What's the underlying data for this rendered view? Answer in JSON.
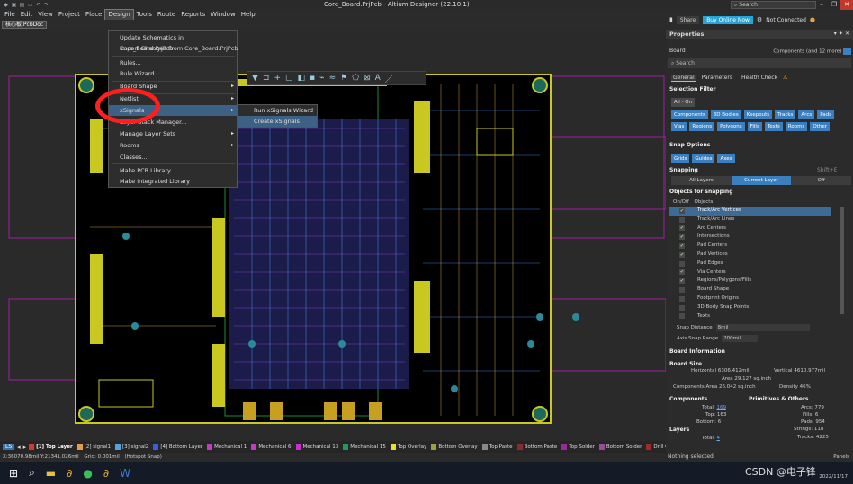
{
  "window": {
    "title": "Core_Board.PrjPcb - Altium Designer (22.10.1)",
    "search": "Search"
  },
  "menubar": {
    "items": [
      "File",
      "Edit",
      "View",
      "Project",
      "Place",
      "Design",
      "Tools",
      "Route",
      "Reports",
      "Window",
      "Help"
    ],
    "active": "Design"
  },
  "header": {
    "share": "Share",
    "buy": "Buy Online Now",
    "not_connected": "Not Connected"
  },
  "document_tab": "核心板.PcbDoc",
  "design_menu": {
    "items": [
      {
        "label": "Update Schematics in Core_Board.PrjPcb"
      },
      {
        "label": "Import Changes From Core_Board.PrjPcb"
      },
      {
        "label": "Rules..."
      },
      {
        "label": "Rule Wizard..."
      },
      {
        "label": "Board Shape",
        "arrow": "▸"
      },
      {
        "label": "Netlist",
        "arrow": "▸"
      },
      {
        "label": "xSignals",
        "arrow": "▸"
      },
      {
        "label": "Layer Stack Manager..."
      },
      {
        "label": "Manage Layer Sets",
        "arrow": "▸"
      },
      {
        "label": "Rooms",
        "arrow": "▸"
      },
      {
        "label": "Classes..."
      },
      {
        "label": "Make PCB Library"
      },
      {
        "label": "Make Integrated Library"
      }
    ]
  },
  "xsignals_submenu": {
    "items": [
      "Run xSignals Wizard",
      "Create xSignals"
    ]
  },
  "layer_bar": {
    "ls": "LS",
    "layers": [
      {
        "name": "[1] Top Layer",
        "color": "#d63a2a",
        "current": true
      },
      {
        "name": "[2] signal1",
        "color": "#e59c4a"
      },
      {
        "name": "[3] signal2",
        "color": "#4fa3e0"
      },
      {
        "name": "[4] Bottom Layer",
        "color": "#3d5de0"
      },
      {
        "name": "Mechanical 1",
        "color": "#c23bc2"
      },
      {
        "name": "Mechanical 6",
        "color": "#c23bc2"
      },
      {
        "name": "Mechanical 13",
        "color": "#d02bd0"
      },
      {
        "name": "Mechanical 15",
        "color": "#1e9a5a"
      },
      {
        "name": "Top Overlay",
        "color": "#e8e02a"
      },
      {
        "name": "Bottom Overlay",
        "color": "#a0a040"
      },
      {
        "name": "Top Paste",
        "color": "#888888"
      },
      {
        "name": "Bottom Paste",
        "color": "#8a2a2a"
      },
      {
        "name": "Top Solder",
        "color": "#9a2a9a"
      },
      {
        "name": "Bottom Solder",
        "color": "#9a4a9a"
      },
      {
        "name": "Drill Gui",
        "color": "#a02a2a"
      }
    ]
  },
  "status": {
    "coords": "X:36070.98mil Y:21341.026mil",
    "grid": "Grid: 0.001mil",
    "snap": "(Hotspot Snap)",
    "selection": "Nothing selected",
    "panels": "Panels"
  },
  "properties": {
    "title": "Properties",
    "board_label": "Board",
    "selector": "Components (and 12 more)",
    "search": "Search",
    "tabs": [
      "General",
      "Parameters",
      "Health Check"
    ],
    "selection_filter": {
      "header": "Selection Filter",
      "all_on": "All - On",
      "chips": [
        "Components",
        "3D Bodies",
        "Keepouts",
        "Tracks",
        "Arcs",
        "Pads",
        "Vias",
        "Regions",
        "Polygons",
        "Fills",
        "Texts",
        "Rooms",
        "Other"
      ]
    },
    "snap_options": {
      "header": "Snap Options",
      "grid_buttons": [
        "Grids",
        "Guides",
        "Axes"
      ],
      "snapping_label": "Snapping",
      "shortcut": "Shift+E",
      "snapping_modes": [
        "All Layers",
        "Current Layer",
        "Off"
      ],
      "snapping_active": "Current Layer",
      "objects_header": "Objects for snapping",
      "col_onoff": "On/Off",
      "col_objects": "Objects",
      "objects": [
        {
          "name": "Track/Arc Vertices",
          "on": true,
          "hl": true
        },
        {
          "name": "Track/Arc Lines",
          "on": false
        },
        {
          "name": "Arc Centers",
          "on": true
        },
        {
          "name": "Intersections",
          "on": true
        },
        {
          "name": "Pad Centers",
          "on": true
        },
        {
          "name": "Pad Vertices",
          "on": true
        },
        {
          "name": "Pad Edges",
          "on": false
        },
        {
          "name": "Via Centers",
          "on": true
        },
        {
          "name": "Regions/Polygons/Fills",
          "on": true
        },
        {
          "name": "Board Shape",
          "on": false
        },
        {
          "name": "Footprint Origins",
          "on": false
        },
        {
          "name": "3D Body Snap Points",
          "on": false
        },
        {
          "name": "Texts",
          "on": false
        }
      ],
      "snap_distance_label": "Snap Distance",
      "snap_distance": "8mil",
      "axis_range_label": "Axis Snap Range",
      "axis_range": "200mil"
    },
    "board_info": {
      "header": "Board Information",
      "board_size": "Board Size",
      "horizontal_label": "Horizontal",
      "horizontal": "6306.412mil",
      "vertical_label": "Vertical",
      "vertical": "4610.977mil",
      "area_label": "Area",
      "area": "29.127 sq.inch",
      "comp_area_label": "Components Area",
      "comp_area": "26.042 sq.inch",
      "density_label": "Density",
      "density": "46%",
      "components_label": "Components",
      "prims_label": "Primitives & Others",
      "total_label": "Total:",
      "total": "169",
      "top_label": "Top:",
      "top": "163",
      "bottom_label": "Bottom:",
      "bottom": "6",
      "arcs_label": "Arcs:",
      "arcs": "779",
      "fills_label": "Fills:",
      "fills": "6",
      "pads_label": "Pads:",
      "pads": "954",
      "strings_label": "Strings:",
      "strings": "118",
      "tracks_label": "Tracks:",
      "tracks": "4225",
      "layers_label": "Layers",
      "layers_total_label": "Total:",
      "layers_total": "4"
    }
  },
  "taskbar": {
    "watermark": "CSDN @电子锋",
    "date": "2022/11/17"
  }
}
